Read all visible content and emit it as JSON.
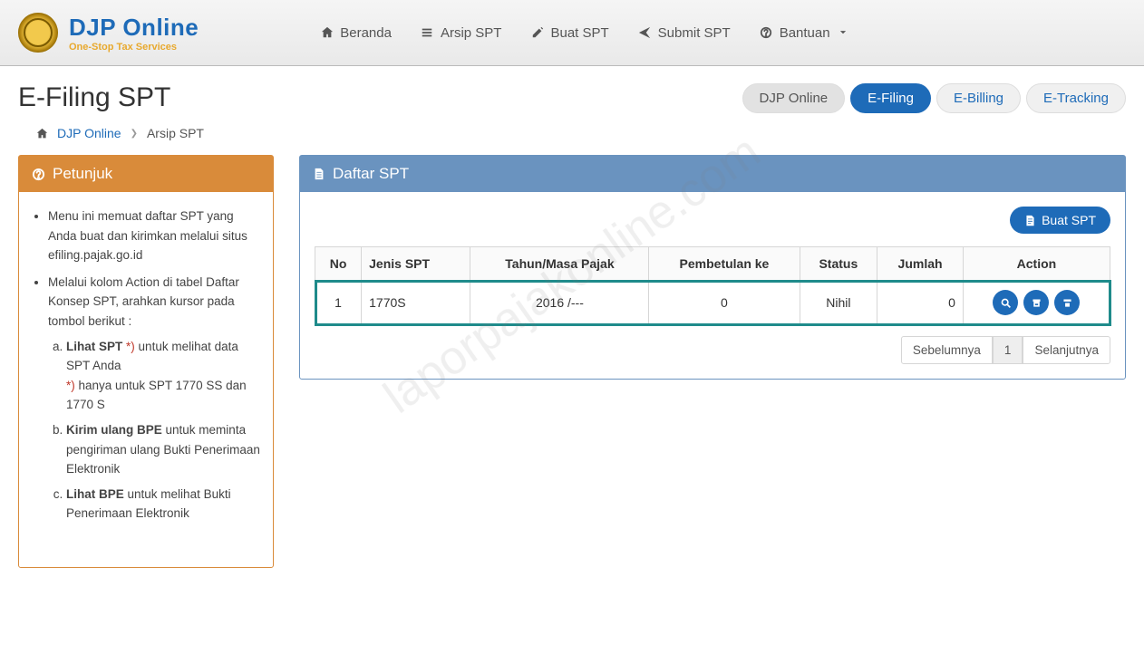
{
  "brand": {
    "title": "DJP Online",
    "subtitle": "One-Stop Tax Services"
  },
  "nav": {
    "beranda": "Beranda",
    "arsip": "Arsip SPT",
    "buat": "Buat SPT",
    "submit": "Submit SPT",
    "bantuan": "Bantuan"
  },
  "page_title": "E-Filing SPT",
  "pills": {
    "djp": "DJP Online",
    "efiling": "E-Filing",
    "ebilling": "E-Billing",
    "etracking": "E-Tracking"
  },
  "breadcrumb": {
    "root": "DJP Online",
    "current": "Arsip SPT"
  },
  "petunjuk": {
    "title": "Petunjuk",
    "b1": "Menu ini memuat daftar SPT yang Anda buat dan kirimkan melalui situs efiling.pajak.go.id",
    "b2": "Melalui kolom Action di tabel Daftar Konsep SPT, arahkan kursor pada tombol berikut :",
    "a_strong": "Lihat SPT",
    "a_mark": "*)",
    "a_tail": " untuk melihat data SPT Anda",
    "a_note": " hanya untuk SPT 1770 SS dan 1770 S",
    "b_strong": "Kirim ulang BPE",
    "b_tail": " untuk meminta pengiriman ulang Bukti Penerimaan Elektronik",
    "c_strong": "Lihat BPE",
    "c_tail": " untuk melihat Bukti Penerimaan Elektronik"
  },
  "daftar": {
    "title": "Daftar SPT",
    "create_label": "Buat SPT",
    "columns": {
      "no": "No",
      "jenis": "Jenis SPT",
      "tahun": "Tahun/Masa Pajak",
      "pembetulan": "Pembetulan ke",
      "status": "Status",
      "jumlah": "Jumlah",
      "action": "Action"
    },
    "rows": [
      {
        "no": "1",
        "jenis": "1770S",
        "tahun": "2016 /---",
        "pembetulan": "0",
        "status": "Nihil",
        "jumlah": "0"
      }
    ],
    "pager": {
      "prev": "Sebelumnya",
      "page": "1",
      "next": "Selanjutnya"
    }
  },
  "watermark": "laporpajakonline.com"
}
